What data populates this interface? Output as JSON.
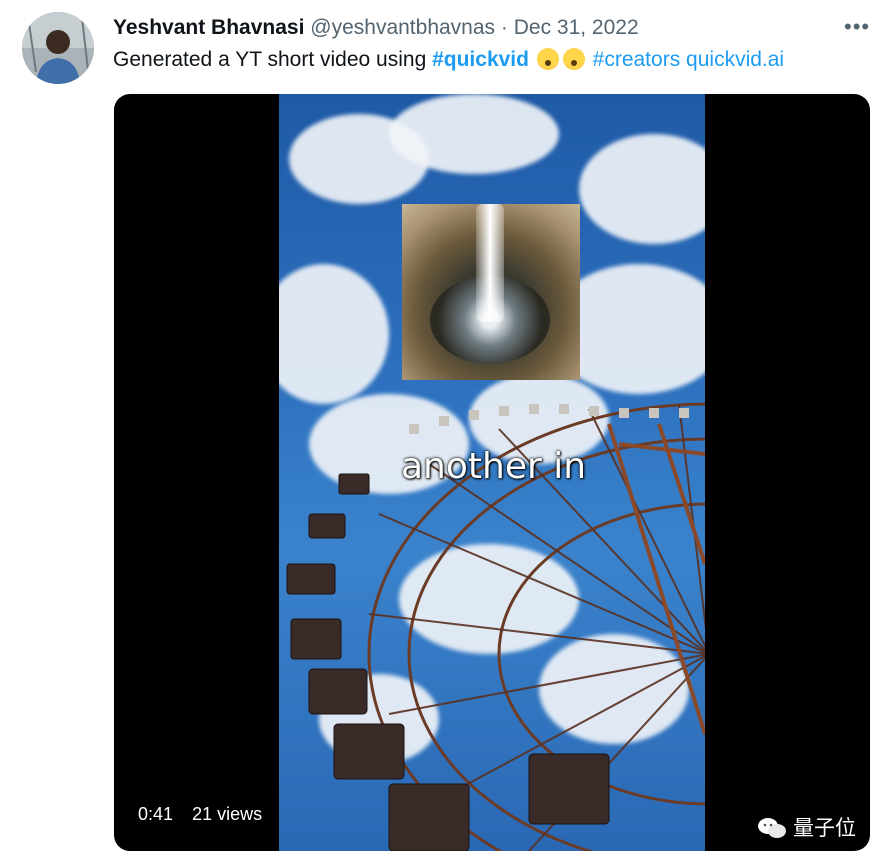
{
  "tweet": {
    "author_name": "Yeshvant Bhavnasi",
    "handle": "@yeshvantbhavnas",
    "separator": "·",
    "date": "Dec 31, 2022",
    "more_label": "•••",
    "text_prefix": "Generated a YT short video using ",
    "hashtag_1": "#quickvid",
    "hashtag_2": "#creators",
    "link": "quickvid.ai",
    "emoji_name": "exploding-head-emoji"
  },
  "video": {
    "caption": "another in",
    "duration": "0:41",
    "views": "21 views"
  },
  "watermark": {
    "text": "量子位"
  }
}
